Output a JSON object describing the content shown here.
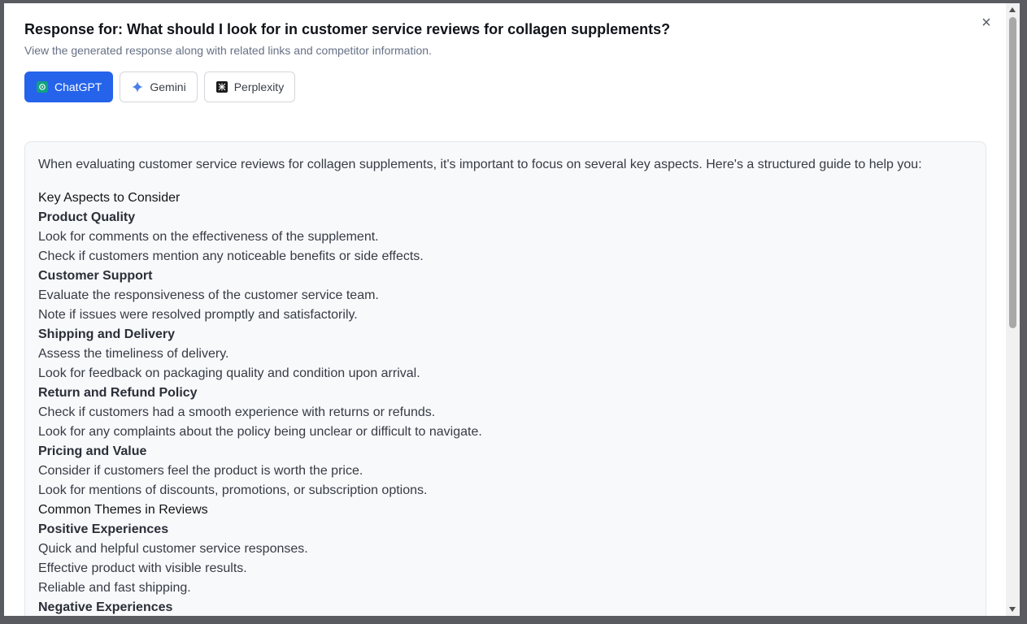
{
  "dialog": {
    "title": "Response for: What should I look for in customer service reviews for collagen supplements?",
    "subtitle": "View the generated response along with related links and competitor information.",
    "close_glyph": "×"
  },
  "tabs": [
    {
      "label": "ChatGPT",
      "icon": "chatgpt-icon",
      "active": true
    },
    {
      "label": "Gemini",
      "icon": "gemini-sparkle-icon",
      "active": false
    },
    {
      "label": "Perplexity",
      "icon": "perplexity-icon",
      "active": false
    }
  ],
  "response": {
    "intro": "When evaluating customer service reviews for collagen supplements, it's important to focus on several key aspects. Here's a structured guide to help you:",
    "lines": [
      {
        "text": "Key Aspects to Consider",
        "style": "heading"
      },
      {
        "text": "Product Quality",
        "style": "bold"
      },
      {
        "text": "Look for comments on the effectiveness of the supplement.",
        "style": "normal"
      },
      {
        "text": "Check if customers mention any noticeable benefits or side effects.",
        "style": "normal"
      },
      {
        "text": "Customer Support",
        "style": "bold"
      },
      {
        "text": "Evaluate the responsiveness of the customer service team.",
        "style": "normal"
      },
      {
        "text": "Note if issues were resolved promptly and satisfactorily.",
        "style": "normal"
      },
      {
        "text": "Shipping and Delivery",
        "style": "bold"
      },
      {
        "text": "Assess the timeliness of delivery.",
        "style": "normal"
      },
      {
        "text": "Look for feedback on packaging quality and condition upon arrival.",
        "style": "normal"
      },
      {
        "text": "Return and Refund Policy",
        "style": "bold"
      },
      {
        "text": "Check if customers had a smooth experience with returns or refunds.",
        "style": "normal"
      },
      {
        "text": "Look for any complaints about the policy being unclear or difficult to navigate.",
        "style": "normal"
      },
      {
        "text": "Pricing and Value",
        "style": "bold"
      },
      {
        "text": "Consider if customers feel the product is worth the price.",
        "style": "normal"
      },
      {
        "text": "Look for mentions of discounts, promotions, or subscription options.",
        "style": "normal"
      },
      {
        "text": "Common Themes in Reviews",
        "style": "heading"
      },
      {
        "text": "Positive Experiences",
        "style": "bold"
      },
      {
        "text": "Quick and helpful customer service responses.",
        "style": "normal"
      },
      {
        "text": "Effective product with visible results.",
        "style": "normal"
      },
      {
        "text": "Reliable and fast shipping.",
        "style": "normal"
      },
      {
        "text": "Negative Experiences",
        "style": "bold"
      }
    ]
  },
  "colors": {
    "accent": "#2563eb",
    "overlay": "#595b60"
  }
}
